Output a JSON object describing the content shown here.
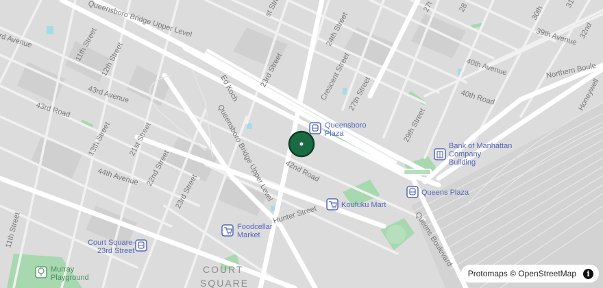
{
  "map": {
    "streets": {
      "queensboro_bridge_upper_level_top": "Queensboro Bridge Upper Level",
      "queensboro_bridge_upper_level_mid": "Queensboro Bridge Upper Level",
      "ed_koch": "Ed Koch",
      "east_street": "st Street",
      "s24th": "24th Street",
      "s23rd": "23rd Street",
      "s23rd_b": "23rd Street",
      "crescent": "Crescent Street",
      "s27th": "27th Street",
      "s29th": "29th Street",
      "s30th": "30th",
      "s31st": "31st",
      "s32nd": "32nd",
      "s27_top": "27t",
      "s28_top": "28",
      "av39": "39th Avenue",
      "av40": "40th Avenue",
      "rd40": "40th Road",
      "northern": "Northern Boule",
      "honeywell": "Honeywell",
      "s11th": "11th Street",
      "s11th_b": "11th Street",
      "s12th": "12th Street",
      "s13th": "13th Street",
      "s21st": "21st Street",
      "s22nd": "22nd Street",
      "av43": "43rd Avenue",
      "rd43": "43rd Road",
      "av44": "44th Avenue",
      "rd42": "42nd Road",
      "hunter": "Hunter Street",
      "qblvd": "Queens Boulevard",
      "avenue_left": "rd Avenue"
    },
    "pois": {
      "queensboro_plaza_1": "Queensboro",
      "queensboro_plaza_2": "Plaza",
      "queens_plaza": "Queens Plaza",
      "bank_1": "Bank of Manhattan",
      "bank_2": "Company",
      "bank_3": "Building",
      "koufuku": "Koufuku Mart",
      "foodcellar_1": "Foodcellar",
      "foodcellar_2": "Market",
      "court_square_1": "Court Square–",
      "court_square_2": "23rd Street",
      "murray_1": "Murray",
      "murray_2": "Playground"
    },
    "neighborhood": {
      "line1": "COURT",
      "line2": "SQUARE"
    },
    "marker": {
      "color": "#1a6b43"
    },
    "colors": {
      "park": "#a8d8b0",
      "water": "#a6dbe8",
      "land": "#dcdcdc",
      "road": "#ffffff",
      "poi_text": "#5566bb"
    }
  },
  "attribution": {
    "text": "Protomaps © OpenStreetMap",
    "info_symbol": "i"
  }
}
